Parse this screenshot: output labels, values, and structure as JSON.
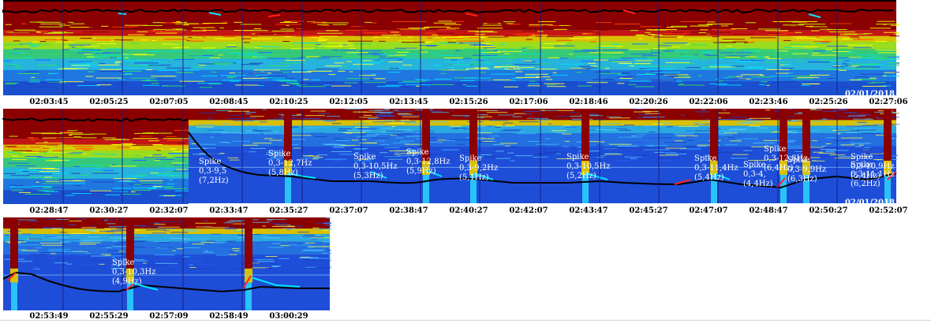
{
  "chart_data": [
    {
      "type": "heatmap",
      "date_label": "02/01/2018",
      "strip_start_tick": "",
      "tick_labels": [
        "02:03:45",
        "02:05:25",
        "02:07:05",
        "02:08:45",
        "02:10:25",
        "02:12:05",
        "02:13:45",
        "02:15:26",
        "02:17:06",
        "02:18:46",
        "02:20:26",
        "02:22:06",
        "02:23:46",
        "02:25:26",
        "02:27:06"
      ],
      "annotations": []
    },
    {
      "type": "heatmap",
      "date_label": "02/01/2018",
      "tick_labels": [
        "02:28:47",
        "02:30:27",
        "02:32:07",
        "02:33:47",
        "02:35:27",
        "02:37:07",
        "02:38:47",
        "02:40:27",
        "02:42:07",
        "02:43:47",
        "02:45:27",
        "02:47:07",
        "02:48:47",
        "02:50:27",
        "02:52:07"
      ],
      "annotations": [
        {
          "lines": [
            "Spike",
            "0,3-9,5",
            "(7,2Hz)"
          ]
        },
        {
          "lines": [
            "Spike",
            "0,3-12,7Hz",
            "(5,8Hz)"
          ]
        },
        {
          "lines": [
            "Spike",
            "0,3-10,5Hz",
            "(5,3Hz)"
          ]
        },
        {
          "lines": [
            "Spike",
            "0,3-12,8Hz",
            "(5,9Hz)"
          ]
        },
        {
          "lines": [
            "Spike",
            "0,3-9,2Hz",
            "(5,1Hz)"
          ]
        },
        {
          "lines": [
            "Spike",
            "0,3-10,5Hz",
            "(5,2Hz)"
          ]
        },
        {
          "lines": [
            "Spike",
            "0,3-11,4Hz",
            "(5,4Hz)"
          ]
        },
        {
          "lines": [
            "Spike",
            "0,3-4,",
            "(4,4Hz)"
          ]
        },
        {
          "lines": [
            "Spike",
            "0,3-12,8Hz",
            "(6,4Hz)"
          ]
        },
        {
          "lines": [
            "Spike",
            "0,3-9,9Hz",
            "(6,3Hz)"
          ]
        },
        {
          "lines": [
            "Spike",
            "0,3-10,9Hz",
            "(5,4Hz)"
          ]
        },
        {
          "lines": [
            "Spike",
            "0,3-11,1Hz",
            "(6,2Hz)"
          ]
        }
      ]
    },
    {
      "type": "heatmap",
      "date_label": "",
      "tick_labels": [
        "02:53:49",
        "02:55:29",
        "02:57:09",
        "02:58:49",
        "03:00:29"
      ],
      "annotations": [
        {
          "lines": [
            "Spike",
            "0,3-10,3Hz",
            "(4,9Hz)"
          ]
        }
      ]
    }
  ],
  "colors": {
    "high": "#8b0000",
    "mid": "#ffff00",
    "low": "#1e50e6",
    "trace_black": "#000000",
    "trace_cyan": "#00e5ff",
    "trace_red": "#ff2020",
    "text_on_plot": "#ffffff"
  }
}
